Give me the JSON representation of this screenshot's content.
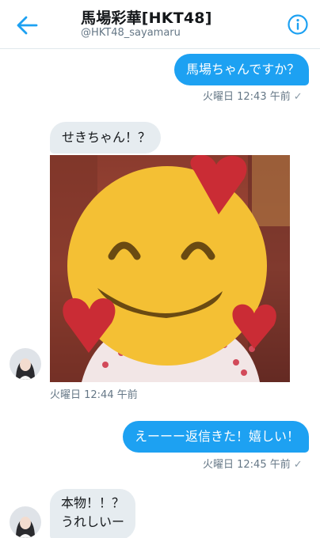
{
  "header": {
    "title": "馬場彩華[HKT48]",
    "handle": "@HKT48_sayamaru",
    "back_icon": "back-arrow-icon",
    "info_icon": "info-icon"
  },
  "messages": [
    {
      "text": "馬場ちゃんですか？",
      "direction": "outgoing",
      "time": "火曜日 12:43 午前",
      "status": "✓"
    },
    {
      "text": "せきちゃん！？",
      "direction": "incoming"
    },
    {
      "media": "photo with smiling-face-with-hearts emoji overlay",
      "direction": "incoming",
      "time": "火曜日 12:44 午前"
    },
    {
      "text": "えーーー返信きた！嬉しい！",
      "direction": "outgoing",
      "time": "火曜日 12:45 午前",
      "status": "✓"
    },
    {
      "line1": "本物！！？",
      "line2": "うれしいー",
      "direction": "incoming"
    }
  ],
  "colors": {
    "outgoing_bubble": "#1da1f2",
    "incoming_bubble": "#e6ecf0",
    "accent": "#1da1f2"
  }
}
